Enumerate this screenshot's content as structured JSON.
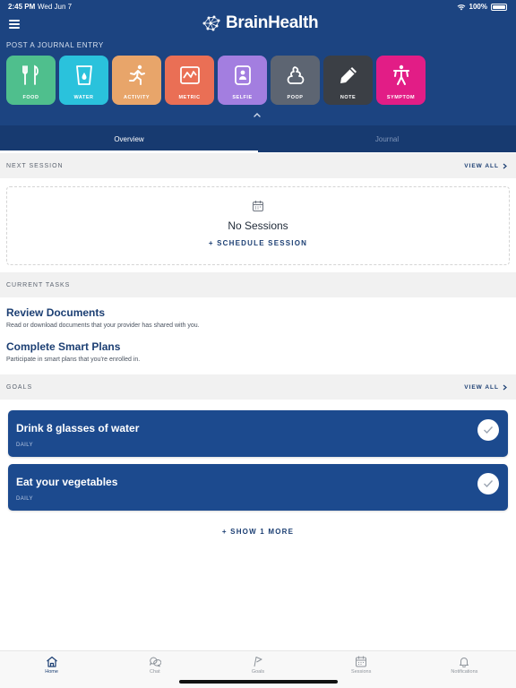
{
  "status": {
    "time": "2:45 PM",
    "date": "Wed Jun 7",
    "battery": "100%"
  },
  "brand": {
    "name": "BrainHealth"
  },
  "journal": {
    "title": "POST A JOURNAL ENTRY",
    "tiles": [
      {
        "label": "FOOD",
        "icon": "fork-knife-icon",
        "color": "#4fbf8d"
      },
      {
        "label": "WATER",
        "icon": "water-glass-icon",
        "color": "#2ac2dc"
      },
      {
        "label": "ACTIVITY",
        "icon": "running-person-icon",
        "color": "#e8a56a"
      },
      {
        "label": "METRIC",
        "icon": "chart-icon",
        "color": "#ea6f55"
      },
      {
        "label": "SELFIE",
        "icon": "selfie-icon",
        "color": "#a37ee0"
      },
      {
        "label": "POOP",
        "icon": "poop-icon",
        "color": "#5d6572"
      },
      {
        "label": "NOTE",
        "icon": "pencil-icon",
        "color": "#3b3f45"
      },
      {
        "label": "SYMPTOM",
        "icon": "body-icon",
        "color": "#e21d86"
      }
    ]
  },
  "tabs": [
    {
      "label": "Overview"
    },
    {
      "label": "Journal"
    }
  ],
  "next_session": {
    "title": "NEXT SESSION",
    "view_all": "VIEW ALL",
    "empty": "No Sessions",
    "schedule": "+ SCHEDULE SESSION"
  },
  "current_tasks": {
    "title": "CURRENT TASKS",
    "items": [
      {
        "title": "Review Documents",
        "desc": "Read or download documents that your provider has shared with you."
      },
      {
        "title": "Complete Smart Plans",
        "desc": "Participate in smart plans that you're enrolled in."
      }
    ]
  },
  "goals": {
    "title": "GOALS",
    "view_all": "VIEW ALL",
    "items": [
      {
        "title": "Drink 8 glasses of water",
        "freq": "DAILY"
      },
      {
        "title": "Eat your vegetables",
        "freq": "DAILY"
      }
    ],
    "show_more": "+ SHOW 1 MORE"
  },
  "nav": [
    {
      "label": "Home",
      "icon": "home-icon"
    },
    {
      "label": "Chat",
      "icon": "chat-icon"
    },
    {
      "label": "Goals",
      "icon": "flag-icon"
    },
    {
      "label": "Sessions",
      "icon": "calendar-icon"
    },
    {
      "label": "Notifications",
      "icon": "bell-icon"
    }
  ],
  "colors": {
    "header": "#1c4481",
    "accent": "#1c3f73"
  }
}
